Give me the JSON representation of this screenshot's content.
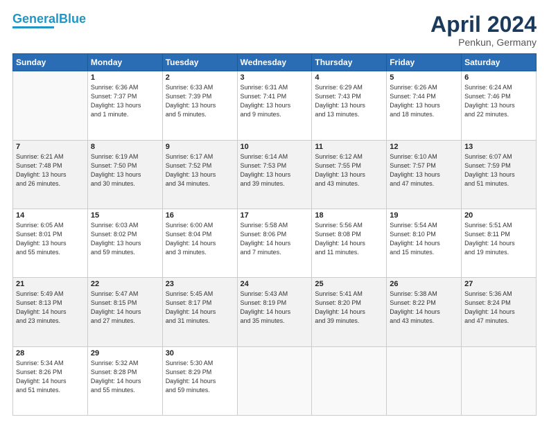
{
  "header": {
    "logo_line1": "General",
    "logo_line2": "Blue",
    "month": "April 2024",
    "location": "Penkun, Germany"
  },
  "days_of_week": [
    "Sunday",
    "Monday",
    "Tuesday",
    "Wednesday",
    "Thursday",
    "Friday",
    "Saturday"
  ],
  "weeks": [
    [
      {
        "day": "",
        "info": ""
      },
      {
        "day": "1",
        "info": "Sunrise: 6:36 AM\nSunset: 7:37 PM\nDaylight: 13 hours\nand 1 minute."
      },
      {
        "day": "2",
        "info": "Sunrise: 6:33 AM\nSunset: 7:39 PM\nDaylight: 13 hours\nand 5 minutes."
      },
      {
        "day": "3",
        "info": "Sunrise: 6:31 AM\nSunset: 7:41 PM\nDaylight: 13 hours\nand 9 minutes."
      },
      {
        "day": "4",
        "info": "Sunrise: 6:29 AM\nSunset: 7:43 PM\nDaylight: 13 hours\nand 13 minutes."
      },
      {
        "day": "5",
        "info": "Sunrise: 6:26 AM\nSunset: 7:44 PM\nDaylight: 13 hours\nand 18 minutes."
      },
      {
        "day": "6",
        "info": "Sunrise: 6:24 AM\nSunset: 7:46 PM\nDaylight: 13 hours\nand 22 minutes."
      }
    ],
    [
      {
        "day": "7",
        "info": "Sunrise: 6:21 AM\nSunset: 7:48 PM\nDaylight: 13 hours\nand 26 minutes."
      },
      {
        "day": "8",
        "info": "Sunrise: 6:19 AM\nSunset: 7:50 PM\nDaylight: 13 hours\nand 30 minutes."
      },
      {
        "day": "9",
        "info": "Sunrise: 6:17 AM\nSunset: 7:52 PM\nDaylight: 13 hours\nand 34 minutes."
      },
      {
        "day": "10",
        "info": "Sunrise: 6:14 AM\nSunset: 7:53 PM\nDaylight: 13 hours\nand 39 minutes."
      },
      {
        "day": "11",
        "info": "Sunrise: 6:12 AM\nSunset: 7:55 PM\nDaylight: 13 hours\nand 43 minutes."
      },
      {
        "day": "12",
        "info": "Sunrise: 6:10 AM\nSunset: 7:57 PM\nDaylight: 13 hours\nand 47 minutes."
      },
      {
        "day": "13",
        "info": "Sunrise: 6:07 AM\nSunset: 7:59 PM\nDaylight: 13 hours\nand 51 minutes."
      }
    ],
    [
      {
        "day": "14",
        "info": "Sunrise: 6:05 AM\nSunset: 8:01 PM\nDaylight: 13 hours\nand 55 minutes."
      },
      {
        "day": "15",
        "info": "Sunrise: 6:03 AM\nSunset: 8:02 PM\nDaylight: 13 hours\nand 59 minutes."
      },
      {
        "day": "16",
        "info": "Sunrise: 6:00 AM\nSunset: 8:04 PM\nDaylight: 14 hours\nand 3 minutes."
      },
      {
        "day": "17",
        "info": "Sunrise: 5:58 AM\nSunset: 8:06 PM\nDaylight: 14 hours\nand 7 minutes."
      },
      {
        "day": "18",
        "info": "Sunrise: 5:56 AM\nSunset: 8:08 PM\nDaylight: 14 hours\nand 11 minutes."
      },
      {
        "day": "19",
        "info": "Sunrise: 5:54 AM\nSunset: 8:10 PM\nDaylight: 14 hours\nand 15 minutes."
      },
      {
        "day": "20",
        "info": "Sunrise: 5:51 AM\nSunset: 8:11 PM\nDaylight: 14 hours\nand 19 minutes."
      }
    ],
    [
      {
        "day": "21",
        "info": "Sunrise: 5:49 AM\nSunset: 8:13 PM\nDaylight: 14 hours\nand 23 minutes."
      },
      {
        "day": "22",
        "info": "Sunrise: 5:47 AM\nSunset: 8:15 PM\nDaylight: 14 hours\nand 27 minutes."
      },
      {
        "day": "23",
        "info": "Sunrise: 5:45 AM\nSunset: 8:17 PM\nDaylight: 14 hours\nand 31 minutes."
      },
      {
        "day": "24",
        "info": "Sunrise: 5:43 AM\nSunset: 8:19 PM\nDaylight: 14 hours\nand 35 minutes."
      },
      {
        "day": "25",
        "info": "Sunrise: 5:41 AM\nSunset: 8:20 PM\nDaylight: 14 hours\nand 39 minutes."
      },
      {
        "day": "26",
        "info": "Sunrise: 5:38 AM\nSunset: 8:22 PM\nDaylight: 14 hours\nand 43 minutes."
      },
      {
        "day": "27",
        "info": "Sunrise: 5:36 AM\nSunset: 8:24 PM\nDaylight: 14 hours\nand 47 minutes."
      }
    ],
    [
      {
        "day": "28",
        "info": "Sunrise: 5:34 AM\nSunset: 8:26 PM\nDaylight: 14 hours\nand 51 minutes."
      },
      {
        "day": "29",
        "info": "Sunrise: 5:32 AM\nSunset: 8:28 PM\nDaylight: 14 hours\nand 55 minutes."
      },
      {
        "day": "30",
        "info": "Sunrise: 5:30 AM\nSunset: 8:29 PM\nDaylight: 14 hours\nand 59 minutes."
      },
      {
        "day": "",
        "info": ""
      },
      {
        "day": "",
        "info": ""
      },
      {
        "day": "",
        "info": ""
      },
      {
        "day": "",
        "info": ""
      }
    ]
  ]
}
